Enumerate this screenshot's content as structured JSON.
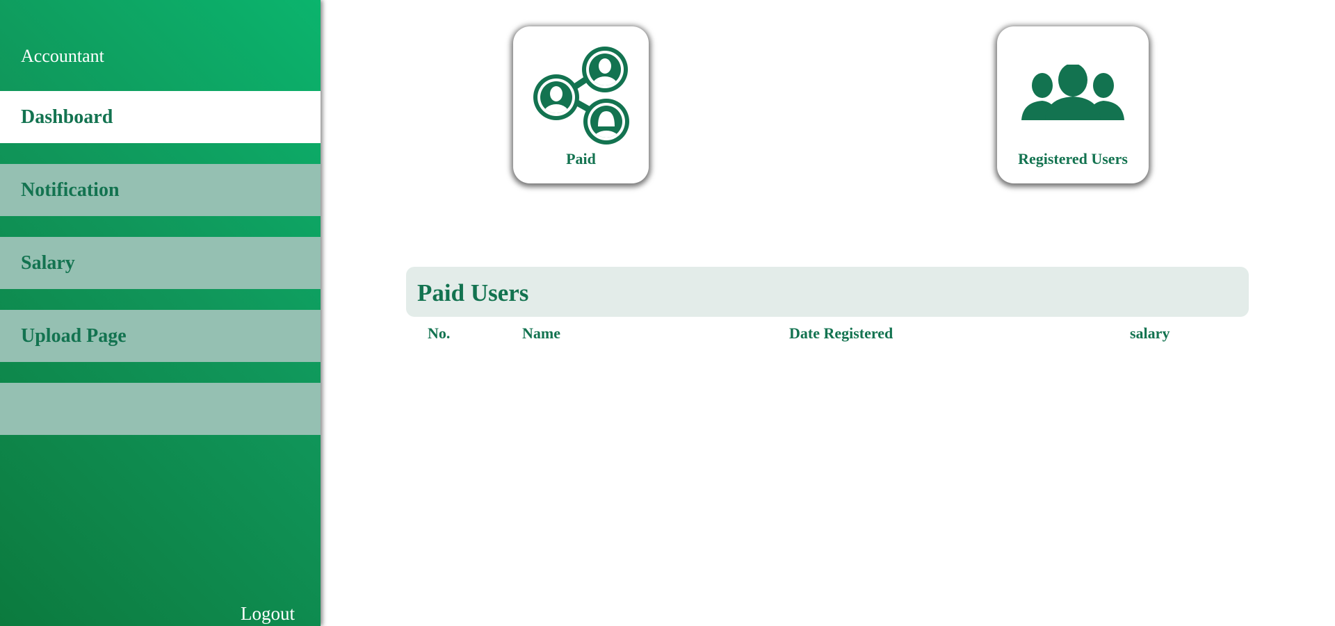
{
  "sidebar": {
    "brand": "Accountant",
    "items": [
      {
        "label": "Dashboard",
        "active": true
      },
      {
        "label": "Notification",
        "active": false
      },
      {
        "label": "Salary",
        "active": false
      },
      {
        "label": "Upload Page",
        "active": false
      },
      {
        "label": "",
        "active": false
      }
    ],
    "logout": "Logout"
  },
  "cards": [
    {
      "label": "Paid",
      "icon": "user-network-icon"
    },
    {
      "label": "Registered Users",
      "icon": "user-group-icon"
    }
  ],
  "table": {
    "title": "Paid Users",
    "columns": [
      "No.",
      "Name",
      "Date Registered",
      "salary"
    ],
    "rows": []
  },
  "colors": {
    "primary_green": "#137350",
    "sidebar_gradient_start": "#0bb46d",
    "sidebar_gradient_end": "#0c7a3e",
    "nav_item_bg": "#95c0b2",
    "panel_header_bg": "#e3ece9"
  }
}
